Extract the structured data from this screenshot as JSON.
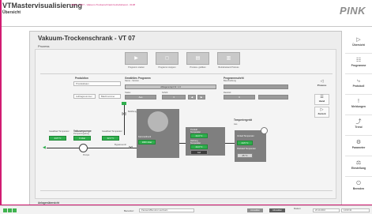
{
  "header": {
    "title": "VTMastervisualisierung",
    "subtitle": "Übersicht",
    "message": "INFO - VT07 - Vakuum-Trockenschrank betriebsbereit - 0108",
    "brand": "PINK"
  },
  "panel": {
    "title": "Vakuum-Trockenschrank - VT 07",
    "subtitle": "Prozess",
    "footer_label": "Anlagenübersicht"
  },
  "actions": [
    {
      "icon": "▶",
      "label": "Programm starten"
    },
    {
      "icon": "◻",
      "label": "Programm stoppen"
    },
    {
      "icon": "▤",
      "label": "Prozess- grafiken"
    },
    {
      "icon": "▥",
      "label": "Betriebsstand Prozess"
    }
  ],
  "sections": {
    "produktion": {
      "title": "Produktion",
      "field1": "Produktdaten",
      "field2": "Auftragsnummer",
      "field3": "Batchnummer"
    },
    "programm": {
      "title": "Gewähltes Programm",
      "sub": "Name - Version",
      "select": "Ablagerezept Nr. 1.0",
      "status_label": "Status",
      "status_val": "Aus",
      "schritt_label": "Schritt",
      "schritt_val": "3"
    },
    "prog_schritt": {
      "title": "Programmschritt",
      "sub": "Beschreibung",
      "dauer_label": "Restzeit",
      "dauer_val": "0"
    }
  },
  "process": {
    "vacuum_pump_label": "Vakuumpumpe",
    "vacuum_pump_sub": "Pumpenregelung",
    "vacuum_pump_value": "0 mbar",
    "left_temp_label": "Gasablauf Temperatur",
    "left_temp_value": "24.5 °C",
    "right_temp_label": "Gasablauf Temperatur",
    "right_temp_value": "22.3 °C",
    "valve_label": "Belüftungs- ventil",
    "pump_sub": "Pumpe",
    "chamber_label": "Kammerdruck",
    "chamber_value": "1000 mbar",
    "chamber_value2": "24.3 °C",
    "chamber_status": "Auf",
    "heat_label1": "Produkt Temperatur",
    "heat_value1": "24.3 °C",
    "heat_label2": "Heizung Temperatur",
    "heat_value2": "24.3 °C",
    "heater_title": "Temperiergerät",
    "heater_status": "Aus",
    "heater_temp_label": "Vorlauf Temperatur",
    "heater_temp_value": "24.5 °C",
    "heater_temp2_label": "Rücklauf Temperatur",
    "heater_temp2_value": "25 °C",
    "bypass_label": "Bypassventil"
  },
  "midnav": [
    {
      "icon": "◁",
      "label": "Prozess"
    },
    {
      "icon": "☰",
      "label": "Hand"
    },
    {
      "icon": "▷",
      "label": "Zurück"
    }
  ],
  "nav": [
    {
      "icon": "▷",
      "label": "Übersicht"
    },
    {
      "icon": "☷",
      "label": "Programme"
    },
    {
      "icon": "⤷",
      "label": "Protokoll"
    },
    {
      "icon": "!",
      "label": "Meldungen"
    },
    {
      "icon": "⤴",
      "label": "Trend"
    },
    {
      "icon": "⚙",
      "label": "Parameter"
    },
    {
      "icon": "⚖",
      "label": "Einstellung"
    },
    {
      "icon": "⏻",
      "label": "Beenden"
    }
  ],
  "footer": {
    "user_label": "Benutzer:",
    "user_value": "Passwort/Benutzer wechseln",
    "btn1": "Anmelden",
    "btn2": "Abmelden",
    "date_label": "Datum",
    "date_value": "26.10.2016",
    "time_value": "14:03:42"
  }
}
